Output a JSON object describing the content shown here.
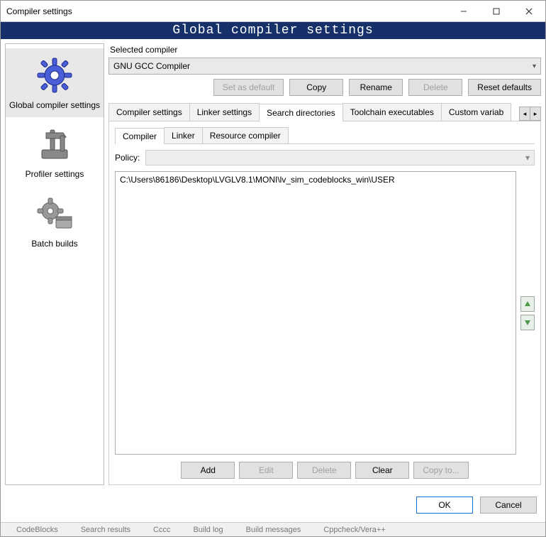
{
  "window": {
    "title": "Compiler settings",
    "banner": "Global compiler settings"
  },
  "nav": {
    "items": [
      {
        "label": "Global compiler settings",
        "selected": true
      },
      {
        "label": "Profiler settings",
        "selected": false
      },
      {
        "label": "Batch builds",
        "selected": false
      }
    ]
  },
  "selectedCompiler": {
    "label": "Selected compiler",
    "value": "GNU GCC Compiler",
    "buttons": {
      "setDefault": "Set as default",
      "copy": "Copy",
      "rename": "Rename",
      "delete": "Delete",
      "reset": "Reset defaults"
    }
  },
  "outerTabs": {
    "items": [
      "Compiler settings",
      "Linker settings",
      "Search directories",
      "Toolchain executables",
      "Custom variab"
    ],
    "activeIndex": 2
  },
  "innerTabs": {
    "items": [
      "Compiler",
      "Linker",
      "Resource compiler"
    ],
    "activeIndex": 0
  },
  "policy": {
    "label": "Policy:",
    "value": ""
  },
  "directories": [
    "C:\\Users\\86186\\Desktop\\LVGLV8.1\\MONI\\lv_sim_codeblocks_win\\USER"
  ],
  "listButtons": {
    "add": "Add",
    "edit": "Edit",
    "delete": "Delete",
    "clear": "Clear",
    "copyTo": "Copy to..."
  },
  "footer": {
    "ok": "OK",
    "cancel": "Cancel"
  },
  "taskbar": {
    "frag1": "CodeBlocks",
    "frag2": "Search results",
    "frag3": "Cccc",
    "frag4": "Build log",
    "frag5": "Build messages",
    "frag6": "Cppcheck/Vera++"
  }
}
